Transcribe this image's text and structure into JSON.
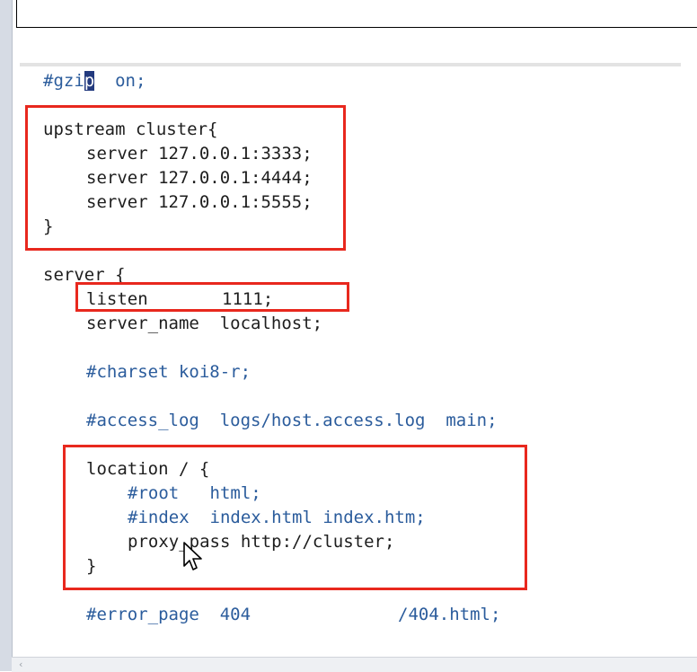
{
  "editor": {
    "lines": {
      "gzip_a": "#gzi",
      "gzip_sel": "p",
      "gzip_b": "  on;",
      "upstream": "upstream cluster{",
      "server1": "server 127.0.0.1:3333;",
      "server2": "server 127.0.0.1:4444;",
      "server3": "server 127.0.0.1:5555;",
      "close1": "}",
      "server_block": "server {",
      "listen_kw": "listen",
      "listen_val": "1111;",
      "server_name": "server_name  localhost;",
      "charset": "#charset koi8-r;",
      "access_log": "#access_log  logs/host.access.log  main;",
      "location": "location / {",
      "root": "#root   html;",
      "index": "#index  index.html index.htm;",
      "proxy_pass": "proxy_pass http://cluster;",
      "close2": "}",
      "error_page_a": "#error_page  404",
      "error_page_b": "/404.html;"
    }
  },
  "colors": {
    "highlight_box": "#e8281e",
    "comment": "#2b5c9c",
    "selection": "#233a7e"
  }
}
